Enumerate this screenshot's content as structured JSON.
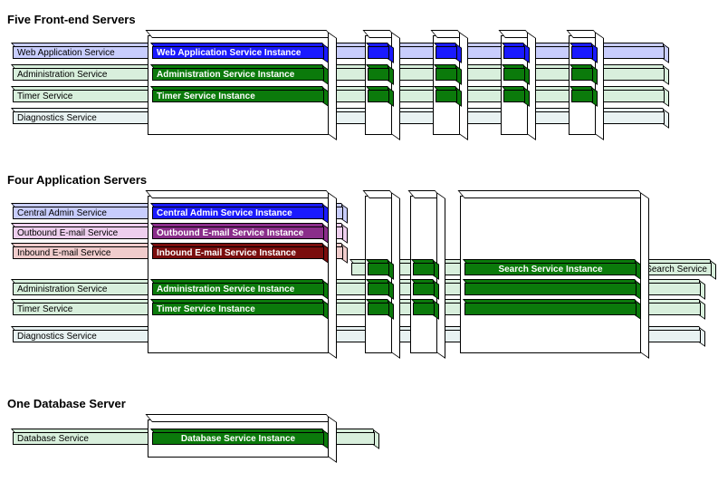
{
  "sections": {
    "frontend": {
      "title": "Five Front-end Servers"
    },
    "app": {
      "title": "Four Application Servers"
    },
    "db": {
      "title": "One Database Server"
    }
  },
  "services": {
    "web_app": "Web Application Service",
    "administration": "Administration Service",
    "timer": "Timer Service",
    "diagnostics": "Diagnostics Service",
    "central_admin": "Central Admin Service",
    "outbound_email": "Outbound E-mail Service",
    "inbound_email": "Inbound E-mail Service",
    "search": "Search Service",
    "database": "Database Service"
  },
  "instances": {
    "web_app": "Web Application Service Instance",
    "administration": "Administration Service Instance",
    "timer": "Timer Service Instance",
    "central_admin": "Central Admin Service Instance",
    "outbound_email": "Outbound E-mail Service Instance",
    "inbound_email": "Inbound E-mail Service Instance",
    "search": "Search Service Instance",
    "database": "Database Service Instance"
  },
  "layout": {
    "frontend_servers": 5,
    "app_small_servers": 3,
    "app_large_servers": 1,
    "db_servers": 1
  }
}
